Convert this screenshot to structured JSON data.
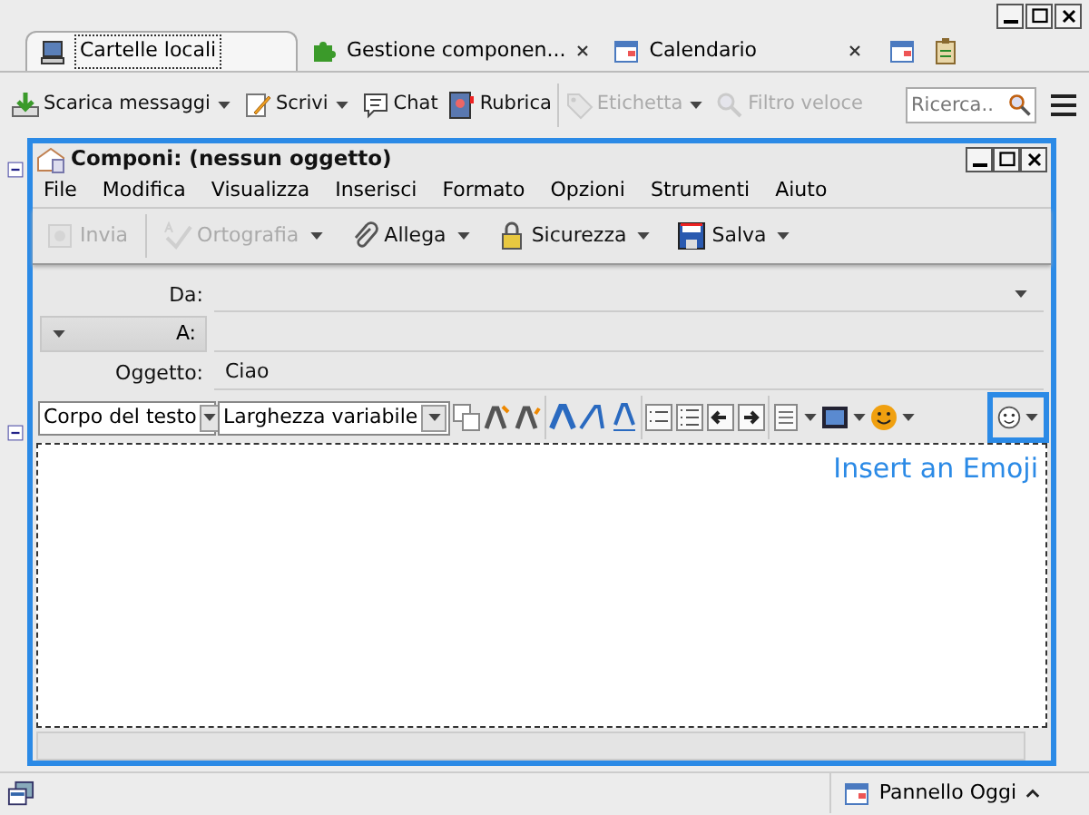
{
  "tabs": [
    {
      "label": "Cartelle locali",
      "selected": true,
      "closable": false
    },
    {
      "label": "Gestione componen...",
      "selected": false,
      "closable": true
    },
    {
      "label": "Calendario",
      "selected": false,
      "closable": true
    }
  ],
  "toolbar": [
    {
      "label": "Scarica messaggi",
      "disabled": false,
      "dropdown": true
    },
    {
      "label": "Scrivi",
      "disabled": false,
      "dropdown": true
    },
    {
      "label": "Chat",
      "disabled": false,
      "dropdown": false
    },
    {
      "label": "Rubrica",
      "disabled": false,
      "dropdown": false
    },
    {
      "label": "Etichetta",
      "disabled": true,
      "dropdown": true
    },
    {
      "label": "Filtro veloce",
      "disabled": true,
      "dropdown": false
    }
  ],
  "search": {
    "placeholder": "Ricerca.."
  },
  "compose": {
    "title": "Componi: (nessun oggetto)",
    "menu": [
      "File",
      "Modifica",
      "Visualizza",
      "Inserisci",
      "Formato",
      "Opzioni",
      "Strumenti",
      "Aiuto"
    ],
    "toolbar": [
      {
        "label": "Invia",
        "disabled": true,
        "dropdown": false
      },
      {
        "label": "Ortografia",
        "disabled": true,
        "dropdown": true
      },
      {
        "label": "Allega",
        "disabled": false,
        "dropdown": true
      },
      {
        "label": "Sicurezza",
        "disabled": false,
        "dropdown": true
      },
      {
        "label": "Salva",
        "disabled": false,
        "dropdown": true
      }
    ],
    "headers": [
      {
        "label": "Da:",
        "kind": "from"
      },
      {
        "label": "A:",
        "kind": "to"
      },
      {
        "label": "Oggetto:",
        "value": "Ciao",
        "kind": "subject"
      }
    ],
    "paragraph_format": "Corpo del testo",
    "font": "Larghezza variabile",
    "emoji_highlighted": true,
    "annotation": "Insert an Emoji"
  },
  "status_bar": {
    "today_pane": "Pannello Oggi"
  }
}
